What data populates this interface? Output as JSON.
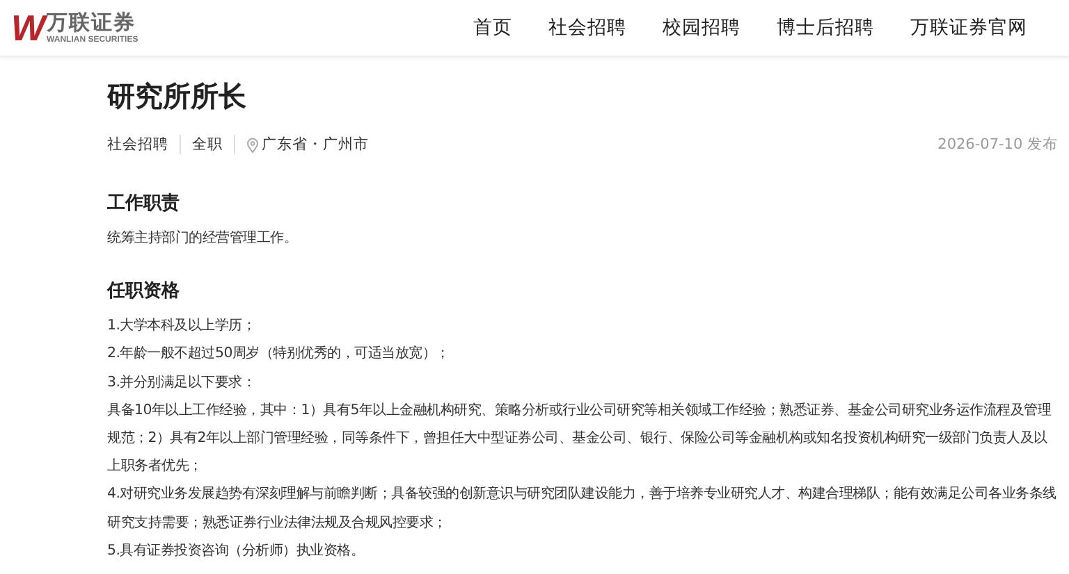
{
  "header": {
    "logo": {
      "mark": "W",
      "name": "万联证券",
      "subtitle": "WANLIAN SECURITIES"
    },
    "nav": [
      {
        "label": "首页"
      },
      {
        "label": "社会招聘"
      },
      {
        "label": "校园招聘"
      },
      {
        "label": "博士后招聘"
      },
      {
        "label": "万联证券官网"
      }
    ]
  },
  "job": {
    "title": "研究所所长",
    "tags": [
      "社会招聘",
      "全职"
    ],
    "location": "广东省・广州市",
    "date": "2026-07-10 发布"
  },
  "sections": [
    {
      "heading": "工作职责",
      "paragraphs": [
        "统筹主持部门的经营管理工作。"
      ]
    },
    {
      "heading": "任职资格",
      "paragraphs": [
        "1.大学本科及以上学历；",
        "2.年龄一般不超过50周岁（特别优秀的，可适当放宽）；",
        "3.并分别满足以下要求：",
        "具备10年以上工作经验，其中：1）具有5年以上金融机构研究、策略分析或行业公司研究等相关领域工作经验；熟悉证券、基金公司研究业务运作流程及管理规范；2）具有2年以上部门管理经验，同等条件下，曾担任大中型证券公司、基金公司、银行、保险公司等金融机构或知名投资机构研究一级部门负责人及以上职务者优先；",
        "4.对研究业务发展趋势有深刻理解与前瞻判断；具备较强的创新意识与研究团队建设能力，善于培养专业研究人才、构建合理梯队；能有效满足公司各业务条线研究支持需要；熟悉证券行业法律法规及合规风控要求；",
        "5.具有证券投资咨询（分析师）执业资格。"
      ]
    }
  ]
}
